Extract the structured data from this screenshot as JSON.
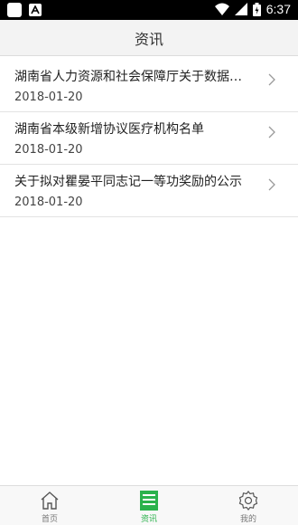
{
  "status_bar": {
    "time": "6:37",
    "icons": [
      "notification-icon",
      "android-icon",
      "wifi-icon",
      "signal-icon",
      "battery-icon"
    ]
  },
  "header": {
    "title": "资讯"
  },
  "news": [
    {
      "title": "湖南省人力资源和社会保障厅关于数据…",
      "date": "2018-01-20"
    },
    {
      "title": "湖南省本级新增协议医疗机构名单",
      "date": "2018-01-20"
    },
    {
      "title": "关于拟对瞿晏平同志记一等功奖励的公示",
      "date": "2018-01-20"
    }
  ],
  "tabbar": {
    "tabs": [
      {
        "label": "首页",
        "icon": "home-icon",
        "active": false
      },
      {
        "label": "资讯",
        "icon": "news-icon",
        "active": true
      },
      {
        "label": "我的",
        "icon": "gear-icon",
        "active": false
      }
    ]
  },
  "colors": {
    "accent": "#2bb24c",
    "header_bg": "#f3f3f3"
  }
}
